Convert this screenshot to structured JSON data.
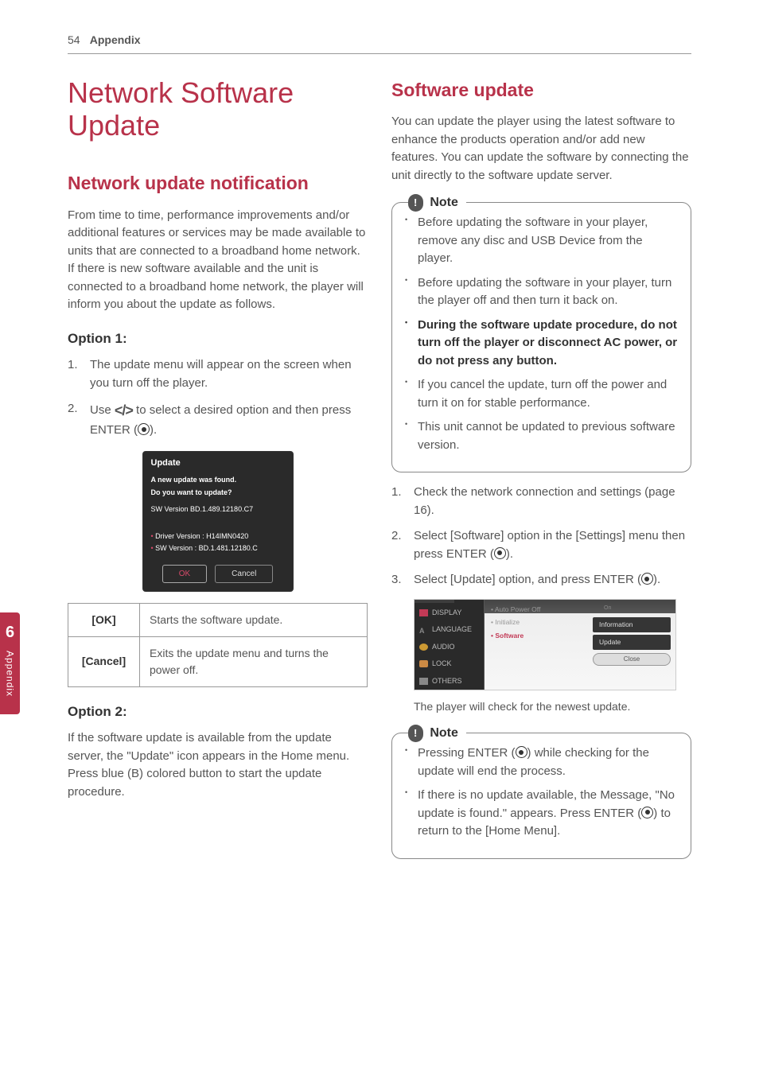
{
  "header": {
    "page_number": "54",
    "section": "Appendix"
  },
  "side_tab": {
    "number": "6",
    "label": "Appendix"
  },
  "left_col": {
    "main_title": "Network Software Update",
    "sub_title": "Network update notification",
    "intro": "From time to time, performance improvements and/or additional features or services may be made available to units that are connected to a broadband home network. If there is new software available and the unit is connected to a broadband home network, the player will inform you about the update as follows.",
    "option1_title": "Option 1:",
    "option1_steps": {
      "s1": "The update menu will appear on the screen when you turn off the player.",
      "s2_pre": "Use ",
      "s2_arrows": "</>",
      "s2_mid": " to select a desired option and then press ENTER (",
      "s2_post": ")."
    },
    "screenshot": {
      "title": "Update",
      "l1": "A new update was found.",
      "l2": "Do you want to update?",
      "l3": "SW Version  BD.1.489.12180.C7",
      "l4": "Driver Version :  H14IMN0420",
      "l5": "SW Version :  BD.1.481.12180.C",
      "ok": "OK",
      "cancel": "Cancel"
    },
    "table": {
      "r1_label": "[OK]",
      "r1_desc": "Starts the software update.",
      "r2_label": "[Cancel]",
      "r2_desc": "Exits the update menu and turns the power off."
    },
    "option2_title": "Option 2:",
    "option2_text": "If the software update is available from the update server, the \"Update\" icon appears in the Home menu. Press blue (B) colored button to start the update procedure."
  },
  "right_col": {
    "sub_title": "Software update",
    "intro": "You can update the player using the latest software to enhance the products operation and/or add new features. You can update the software by connecting the unit directly to the software update server.",
    "note1": {
      "label": "Note",
      "b1": "Before updating the software in your player, remove any disc and USB Device from the player.",
      "b2": "Before updating the software in your player, turn the player off and then turn it back on.",
      "b3": "During the software update procedure, do not turn off the player or disconnect AC power, or do not press any button.",
      "b4": "If you cancel the update, turn off the power and turn it on for stable performance.",
      "b5": "This unit cannot be updated to previous software version."
    },
    "steps": {
      "s1": "Check the network connection and settings (page 16).",
      "s2_pre": "Select [Software] option in the [Settings] menu then press ENTER (",
      "s2_post": ").",
      "s3_pre": "Select [Update] option, and press ENTER (",
      "s3_post": ")."
    },
    "menu_shot": {
      "side": {
        "display": "DISPLAY",
        "language": "LANGUAGE",
        "audio": "AUDIO",
        "lock": "LOCK",
        "others": "OTHERS"
      },
      "mid": {
        "auto": "Auto Power Off",
        "init": "Initialize",
        "software": "Software"
      },
      "right": {
        "on": "On",
        "info": "Information",
        "update": "Update",
        "close": "Close"
      }
    },
    "caption": "The player will check for the newest update.",
    "note2": {
      "label": "Note",
      "b1_pre": "Pressing ENTER (",
      "b1_post": ") while checking for the update will end the process.",
      "b2_pre": "If there is no update available, the Message, \"No update is found.\" appears. Press ENTER (",
      "b2_post": ") to return to the [Home Menu]."
    }
  }
}
